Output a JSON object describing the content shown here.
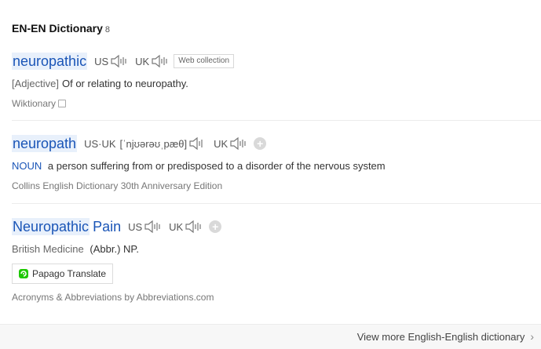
{
  "header": {
    "title": "EN-EN Dictionary",
    "count": "8"
  },
  "entries": [
    {
      "word": "neuropathic",
      "us_label": "US",
      "uk_label": "UK",
      "tag": "Web collection",
      "pos": "[Adjective]",
      "definition": "Of or relating to neuropathy.",
      "source": "Wiktionary"
    },
    {
      "word": "neuropath",
      "us_label": "US·UK",
      "phonetic": "[ˈnjʊərəʊˌpæθ]",
      "uk_label": "UK",
      "pos": "NOUN",
      "definition": "a person suffering from or predisposed to a disorder of the nervous system",
      "source": "Collins English Dictionary 30th Anniversary Edition"
    },
    {
      "word": "Neuropathic",
      "word_rest": "Pain",
      "us_label": "US",
      "uk_label": "UK",
      "pos": "British Medicine",
      "definition": "(Abbr.) NP.",
      "translate_button": "Papago Translate",
      "source": "Acronyms & Abbreviations by Abbreviations.com"
    }
  ],
  "footer": {
    "more_link": "View more English-English dictionary"
  },
  "colors": {
    "accent": "#1a55b7",
    "highlight": "#e8f0fb",
    "papago_green": "#1ec800"
  },
  "icons": [
    "speaker-icon",
    "plus-icon",
    "copy-icon",
    "papago-logo-icon",
    "chevron-right-icon"
  ]
}
